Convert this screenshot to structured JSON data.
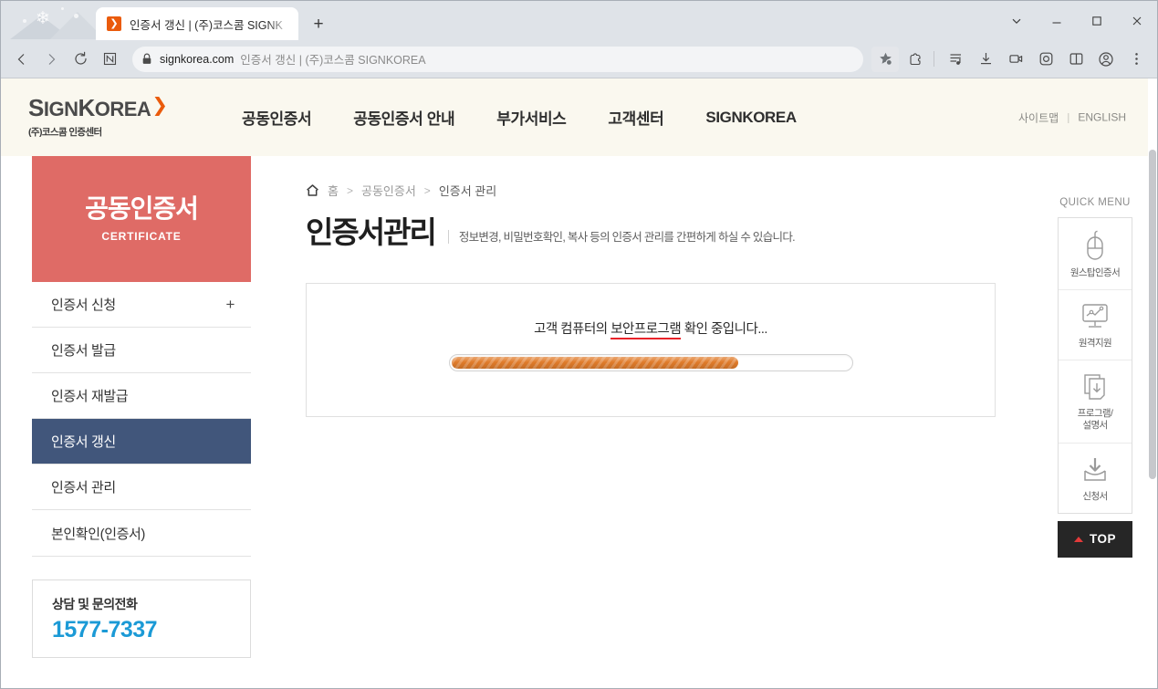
{
  "browser": {
    "tab": {
      "title": "인증서 갱신 | (주)코스콤 SIGNK",
      "favicon_glyph": "❯",
      "new_tab_label": "+"
    },
    "address": {
      "domain": "signkorea.com",
      "page_title": "인증서 갱신 | (주)코스콤 SIGNKOREA"
    },
    "toolbar_icons": [
      "favorites-icon",
      "extensions-icon",
      "collections-icon",
      "downloads-icon",
      "screen-capture-icon",
      "screenshot-icon",
      "split-screen-icon",
      "profile-icon",
      "settings-menu-icon"
    ],
    "window_controls": [
      "tab-search",
      "minimize",
      "maximize",
      "close"
    ]
  },
  "site": {
    "logo": {
      "name_part1": "S",
      "name_part2": "IGN",
      "name_part3": "K",
      "name_part4": "OREA",
      "arrow": "❯",
      "subtitle": "(주)코스콤 인증센터"
    },
    "nav": [
      {
        "label": "공동인증서"
      },
      {
        "label": "공동인증서 안내"
      },
      {
        "label": "부가서비스"
      },
      {
        "label": "고객센터"
      },
      {
        "label": "SIGNKOREA"
      }
    ],
    "util_nav": {
      "sitemap": "사이트맵",
      "separator": "|",
      "english": "ENGLISH"
    }
  },
  "sidebar": {
    "banner": {
      "title": "공동인증서",
      "subtitle": "CERTIFICATE"
    },
    "items": [
      {
        "label": "인증서 신청",
        "expand": "+",
        "active": false
      },
      {
        "label": "인증서 발급",
        "expand": "",
        "active": false
      },
      {
        "label": "인증서 재발급",
        "expand": "",
        "active": false
      },
      {
        "label": "인증서 갱신",
        "expand": "",
        "active": true
      },
      {
        "label": "인증서 관리",
        "expand": "",
        "active": false
      },
      {
        "label": "본인확인(인증서)",
        "expand": "",
        "active": false
      }
    ],
    "contact": {
      "label": "상담 및 문의전화",
      "phone": "1577-7337"
    }
  },
  "main": {
    "breadcrumb": {
      "home": "홈",
      "sep1": ">",
      "level2": "공동인증서",
      "sep2": ">",
      "current": "인증서 관리"
    },
    "page_title": "인증서관리",
    "page_subtitle": "정보변경, 비밀번호확인, 복사 등의 인증서 관리를 간편하게 하실 수 있습니다.",
    "status_panel": {
      "message_prefix": "고객 컴퓨터의 ",
      "message_highlight": "보안프로그램",
      "message_suffix": " 확인 중입니다...",
      "progress_percent": 72
    }
  },
  "quick_menu": {
    "title": "QUICK MENU",
    "items": [
      {
        "label": "원스탑인증서",
        "icon": "mouse-icon"
      },
      {
        "label": "원격지원",
        "icon": "remote-monitor-icon"
      },
      {
        "label": "프로그램/\n설명서",
        "icon": "documents-download-icon"
      },
      {
        "label": "신청서",
        "icon": "download-tray-icon"
      }
    ],
    "top_button": "TOP"
  },
  "colors": {
    "brand_red": "#DF6B66",
    "active_navy": "#41567B",
    "accent_orange": "#EA5B0C",
    "progress_orange": "#E07B2A",
    "phone_blue": "#1B9AD6",
    "header_cream": "#FAF8EF",
    "underline_red": "#E8232A"
  }
}
